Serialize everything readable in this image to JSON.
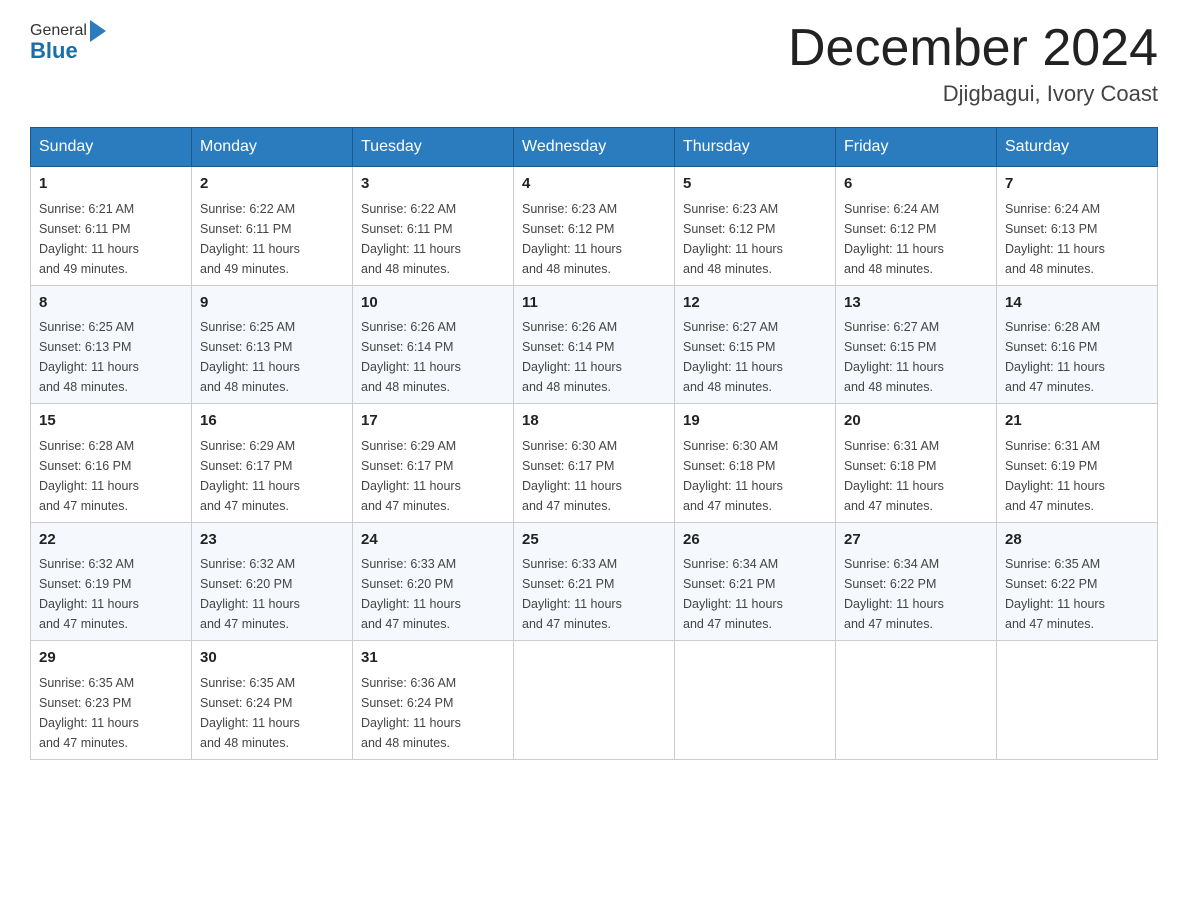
{
  "header": {
    "logo_general": "General",
    "logo_blue": "Blue",
    "title": "December 2024",
    "location": "Djigbagui, Ivory Coast"
  },
  "days_of_week": [
    "Sunday",
    "Monday",
    "Tuesday",
    "Wednesday",
    "Thursday",
    "Friday",
    "Saturday"
  ],
  "weeks": [
    [
      {
        "day": "1",
        "sunrise": "6:21 AM",
        "sunset": "6:11 PM",
        "daylight": "11 hours and 49 minutes."
      },
      {
        "day": "2",
        "sunrise": "6:22 AM",
        "sunset": "6:11 PM",
        "daylight": "11 hours and 49 minutes."
      },
      {
        "day": "3",
        "sunrise": "6:22 AM",
        "sunset": "6:11 PM",
        "daylight": "11 hours and 48 minutes."
      },
      {
        "day": "4",
        "sunrise": "6:23 AM",
        "sunset": "6:12 PM",
        "daylight": "11 hours and 48 minutes."
      },
      {
        "day": "5",
        "sunrise": "6:23 AM",
        "sunset": "6:12 PM",
        "daylight": "11 hours and 48 minutes."
      },
      {
        "day": "6",
        "sunrise": "6:24 AM",
        "sunset": "6:12 PM",
        "daylight": "11 hours and 48 minutes."
      },
      {
        "day": "7",
        "sunrise": "6:24 AM",
        "sunset": "6:13 PM",
        "daylight": "11 hours and 48 minutes."
      }
    ],
    [
      {
        "day": "8",
        "sunrise": "6:25 AM",
        "sunset": "6:13 PM",
        "daylight": "11 hours and 48 minutes."
      },
      {
        "day": "9",
        "sunrise": "6:25 AM",
        "sunset": "6:13 PM",
        "daylight": "11 hours and 48 minutes."
      },
      {
        "day": "10",
        "sunrise": "6:26 AM",
        "sunset": "6:14 PM",
        "daylight": "11 hours and 48 minutes."
      },
      {
        "day": "11",
        "sunrise": "6:26 AM",
        "sunset": "6:14 PM",
        "daylight": "11 hours and 48 minutes."
      },
      {
        "day": "12",
        "sunrise": "6:27 AM",
        "sunset": "6:15 PM",
        "daylight": "11 hours and 48 minutes."
      },
      {
        "day": "13",
        "sunrise": "6:27 AM",
        "sunset": "6:15 PM",
        "daylight": "11 hours and 48 minutes."
      },
      {
        "day": "14",
        "sunrise": "6:28 AM",
        "sunset": "6:16 PM",
        "daylight": "11 hours and 47 minutes."
      }
    ],
    [
      {
        "day": "15",
        "sunrise": "6:28 AM",
        "sunset": "6:16 PM",
        "daylight": "11 hours and 47 minutes."
      },
      {
        "day": "16",
        "sunrise": "6:29 AM",
        "sunset": "6:17 PM",
        "daylight": "11 hours and 47 minutes."
      },
      {
        "day": "17",
        "sunrise": "6:29 AM",
        "sunset": "6:17 PM",
        "daylight": "11 hours and 47 minutes."
      },
      {
        "day": "18",
        "sunrise": "6:30 AM",
        "sunset": "6:17 PM",
        "daylight": "11 hours and 47 minutes."
      },
      {
        "day": "19",
        "sunrise": "6:30 AM",
        "sunset": "6:18 PM",
        "daylight": "11 hours and 47 minutes."
      },
      {
        "day": "20",
        "sunrise": "6:31 AM",
        "sunset": "6:18 PM",
        "daylight": "11 hours and 47 minutes."
      },
      {
        "day": "21",
        "sunrise": "6:31 AM",
        "sunset": "6:19 PM",
        "daylight": "11 hours and 47 minutes."
      }
    ],
    [
      {
        "day": "22",
        "sunrise": "6:32 AM",
        "sunset": "6:19 PM",
        "daylight": "11 hours and 47 minutes."
      },
      {
        "day": "23",
        "sunrise": "6:32 AM",
        "sunset": "6:20 PM",
        "daylight": "11 hours and 47 minutes."
      },
      {
        "day": "24",
        "sunrise": "6:33 AM",
        "sunset": "6:20 PM",
        "daylight": "11 hours and 47 minutes."
      },
      {
        "day": "25",
        "sunrise": "6:33 AM",
        "sunset": "6:21 PM",
        "daylight": "11 hours and 47 minutes."
      },
      {
        "day": "26",
        "sunrise": "6:34 AM",
        "sunset": "6:21 PM",
        "daylight": "11 hours and 47 minutes."
      },
      {
        "day": "27",
        "sunrise": "6:34 AM",
        "sunset": "6:22 PM",
        "daylight": "11 hours and 47 minutes."
      },
      {
        "day": "28",
        "sunrise": "6:35 AM",
        "sunset": "6:22 PM",
        "daylight": "11 hours and 47 minutes."
      }
    ],
    [
      {
        "day": "29",
        "sunrise": "6:35 AM",
        "sunset": "6:23 PM",
        "daylight": "11 hours and 47 minutes."
      },
      {
        "day": "30",
        "sunrise": "6:35 AM",
        "sunset": "6:24 PM",
        "daylight": "11 hours and 48 minutes."
      },
      {
        "day": "31",
        "sunrise": "6:36 AM",
        "sunset": "6:24 PM",
        "daylight": "11 hours and 48 minutes."
      },
      null,
      null,
      null,
      null
    ]
  ],
  "labels": {
    "sunrise": "Sunrise:",
    "sunset": "Sunset:",
    "daylight": "Daylight:"
  }
}
